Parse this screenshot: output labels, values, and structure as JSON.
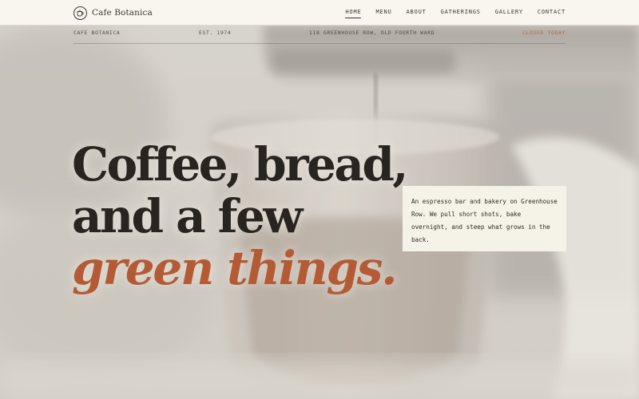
{
  "header": {
    "brand_name": "Cafe Botanica",
    "nav": [
      {
        "label": "HOME",
        "active": true
      },
      {
        "label": "MENU",
        "active": false
      },
      {
        "label": "ABOUT",
        "active": false
      },
      {
        "label": "GATHERINGS",
        "active": false
      },
      {
        "label": "GALLERY",
        "active": false
      },
      {
        "label": "CONTACT",
        "active": false
      }
    ]
  },
  "info": {
    "name": "CAFE BOTANICA",
    "established": "EST. 1974",
    "address": "118 GREENHOUSE ROW, OLD FOURTH WARD",
    "status": "CLOSED TODAY"
  },
  "hero": {
    "headline_line1": "Coffee, bread,",
    "headline_line2": "and a few",
    "headline_accent": "green things.",
    "description": "An espresso bar and bakery on Greenhouse Row. We pull short shots, bake overnight, and steep what grows in the back."
  },
  "colors": {
    "accent": "#b45b35",
    "status": "#b4664a",
    "header_bg": "#f8f6ef",
    "card_bg": "#f5f2e7",
    "text": "#28241f"
  },
  "icons": {
    "brand": "coffee-cup-icon"
  }
}
